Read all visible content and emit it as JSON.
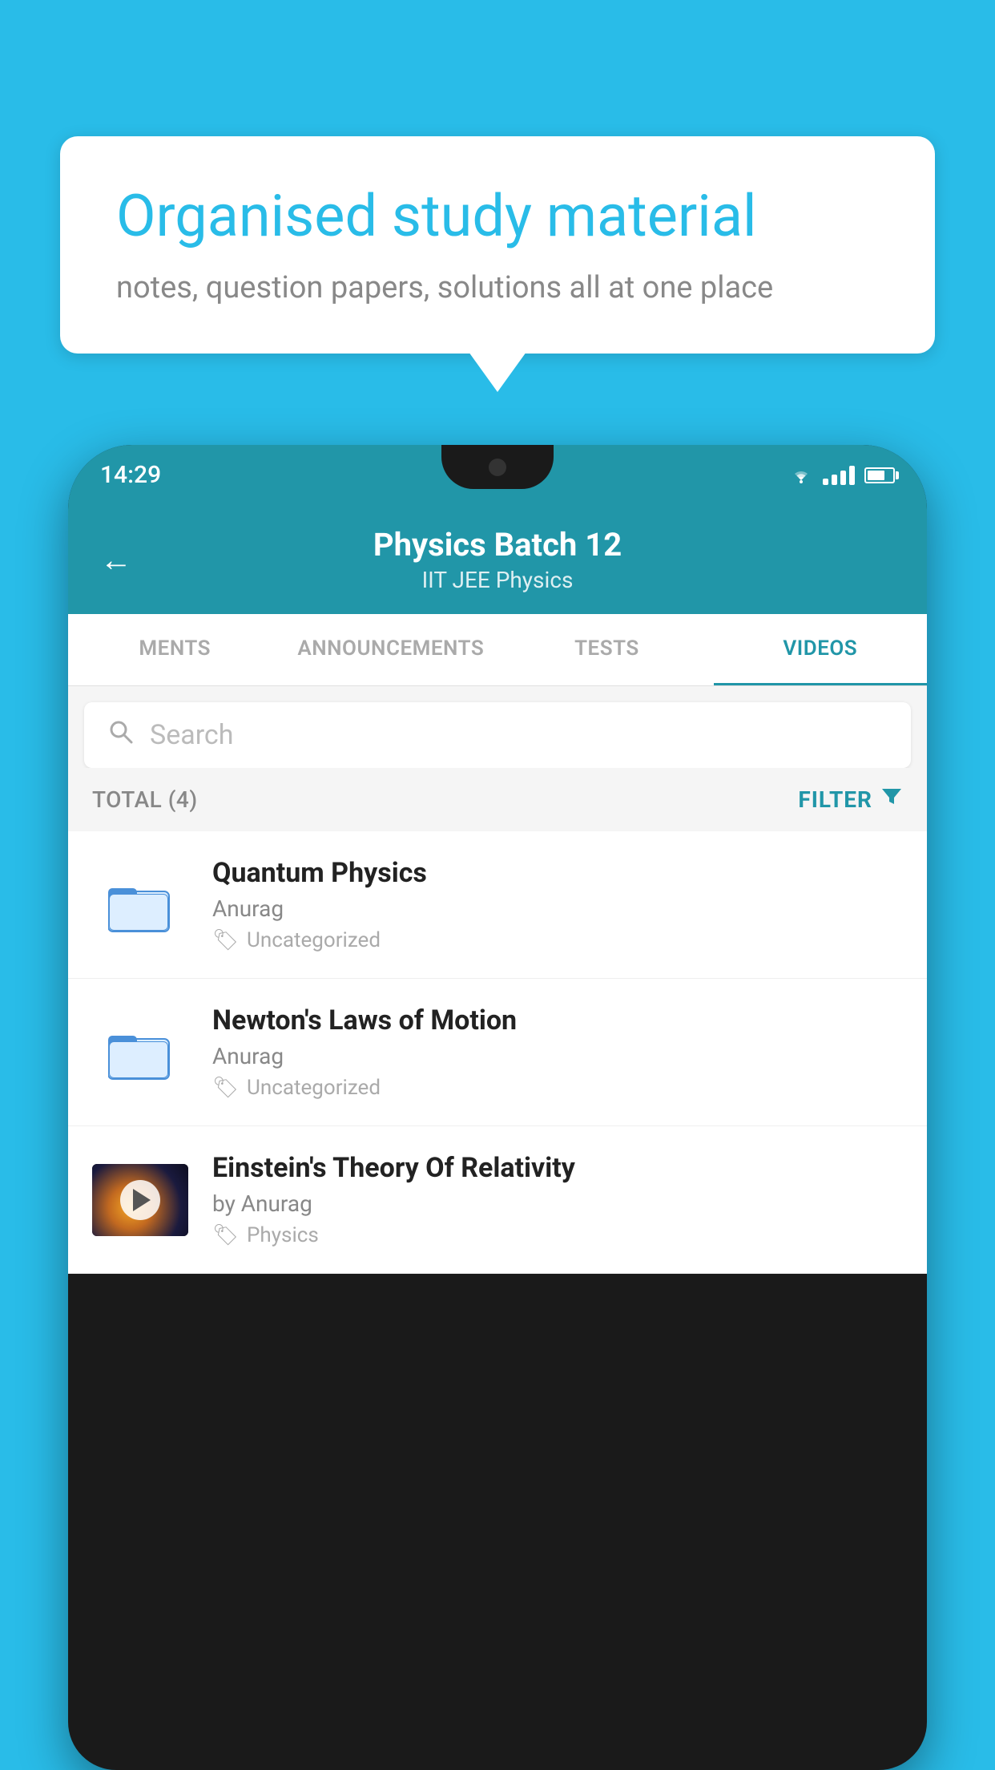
{
  "background_color": "#29bce8",
  "speech_bubble": {
    "title": "Organised study material",
    "subtitle": "notes, question papers, solutions all at one place"
  },
  "status_bar": {
    "time": "14:29"
  },
  "app_header": {
    "title": "Physics Batch 12",
    "subtitle": "IIT JEE   Physics",
    "back_label": "←"
  },
  "tabs": [
    {
      "label": "MENTS",
      "active": false
    },
    {
      "label": "ANNOUNCEMENTS",
      "active": false
    },
    {
      "label": "TESTS",
      "active": false
    },
    {
      "label": "VIDEOS",
      "active": true
    }
  ],
  "search": {
    "placeholder": "Search"
  },
  "filter_bar": {
    "total_label": "TOTAL (4)",
    "filter_label": "FILTER"
  },
  "videos": [
    {
      "title": "Quantum Physics",
      "author": "Anurag",
      "tag": "Uncategorized",
      "type": "folder",
      "has_thumbnail": false
    },
    {
      "title": "Newton's Laws of Motion",
      "author": "Anurag",
      "tag": "Uncategorized",
      "type": "folder",
      "has_thumbnail": false
    },
    {
      "title": "Einstein's Theory Of Relativity",
      "author": "by Anurag",
      "tag": "Physics",
      "type": "video",
      "has_thumbnail": true
    }
  ]
}
